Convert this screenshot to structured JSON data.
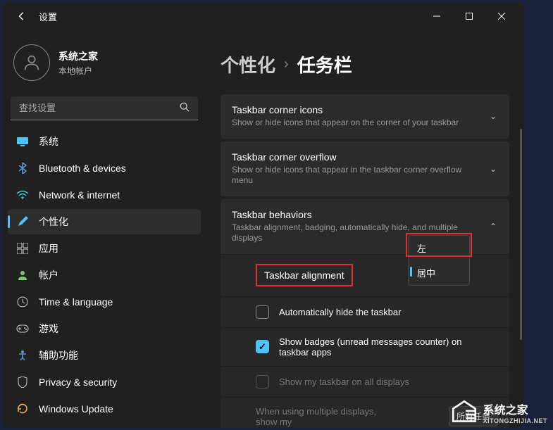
{
  "window": {
    "title": "设置"
  },
  "profile": {
    "name": "系统之家",
    "account": "本地帐户"
  },
  "search": {
    "placeholder": "查找设置"
  },
  "nav": [
    {
      "icon": "system",
      "label": "系统",
      "color": "#4cc2ff"
    },
    {
      "icon": "bluetooth",
      "label": "Bluetooth & devices",
      "color": "#5b9bd5"
    },
    {
      "icon": "wifi",
      "label": "Network & internet",
      "color": "#40c9c9"
    },
    {
      "icon": "brush",
      "label": "个性化",
      "color": "#4cc2ff",
      "selected": true
    },
    {
      "icon": "apps",
      "label": "应用",
      "color": "#ccc"
    },
    {
      "icon": "person",
      "label": "帐户",
      "color": "#7bc96f"
    },
    {
      "icon": "clock",
      "label": "Time & language",
      "color": "#ccc"
    },
    {
      "icon": "game",
      "label": "游戏",
      "color": "#ccc"
    },
    {
      "icon": "access",
      "label": "辅助功能",
      "color": "#5b9bd5"
    },
    {
      "icon": "shield",
      "label": "Privacy & security",
      "color": "#ccc"
    },
    {
      "icon": "update",
      "label": "Windows Update",
      "color": "#ffb84d"
    }
  ],
  "breadcrumb": {
    "parent": "个性化",
    "current": "任务栏"
  },
  "panels": {
    "cornerIcons": {
      "title": "Taskbar corner icons",
      "subtitle": "Show or hide icons that appear on the corner of your taskbar"
    },
    "cornerOverflow": {
      "title": "Taskbar corner overflow",
      "subtitle": "Show or hide icons that appear in the taskbar corner overflow menu"
    },
    "behaviors": {
      "title": "Taskbar behaviors",
      "subtitle": "Taskbar alignment, badging, automatically hide, and multiple displays"
    }
  },
  "behaviors": {
    "alignment": {
      "label": "Taskbar alignment",
      "options": [
        "左",
        "居中"
      ],
      "selected": "居中"
    },
    "autoHide": {
      "label": "Automatically hide the taskbar",
      "checked": false
    },
    "badges": {
      "label": "Show badges (unread messages counter) on taskbar apps",
      "checked": true
    },
    "allDisplays": {
      "label": "Show my taskbar on all displays",
      "checked": false,
      "disabled": true
    },
    "multiDisplay": {
      "label": "When using multiple displays, show my",
      "button": "所有任务"
    }
  },
  "watermark": {
    "text": "系统之家",
    "url": "XITONGZHIJIA.NET"
  }
}
